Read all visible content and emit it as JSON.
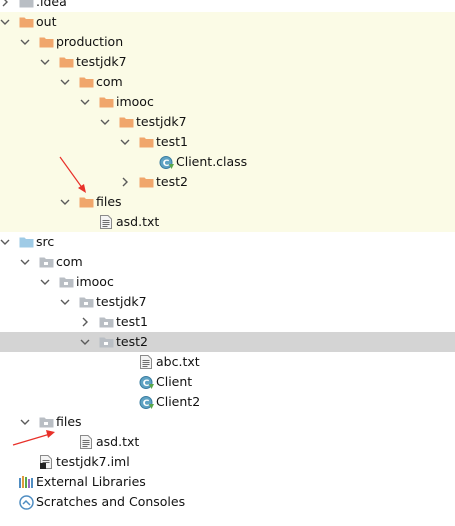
{
  "project_tree": {
    "rows": [
      {
        "label": ".idea",
        "icon": "folder-gray-icon",
        "expanded": false,
        "depth": 0,
        "style": "normal"
      },
      {
        "label": "out",
        "icon": "folder-orange-icon",
        "expanded": true,
        "depth": 0,
        "style": "excluded"
      },
      {
        "label": "production",
        "icon": "folder-orange-icon",
        "expanded": true,
        "depth": 1,
        "style": "excluded"
      },
      {
        "label": "testjdk7",
        "icon": "folder-orange-icon",
        "expanded": true,
        "depth": 2,
        "style": "excluded"
      },
      {
        "label": "com",
        "icon": "folder-orange-icon",
        "expanded": true,
        "depth": 3,
        "style": "excluded"
      },
      {
        "label": "imooc",
        "icon": "folder-orange-icon",
        "expanded": true,
        "depth": 4,
        "style": "excluded"
      },
      {
        "label": "testjdk7",
        "icon": "folder-orange-icon",
        "expanded": true,
        "depth": 5,
        "style": "excluded"
      },
      {
        "label": "test1",
        "icon": "folder-orange-icon",
        "expanded": true,
        "depth": 6,
        "style": "excluded"
      },
      {
        "label": "Client.class",
        "icon": "java-class-icon",
        "expanded": null,
        "depth": 7,
        "style": "excluded"
      },
      {
        "label": "test2",
        "icon": "folder-orange-icon",
        "expanded": false,
        "depth": 6,
        "style": "excluded"
      },
      {
        "label": "files",
        "icon": "folder-orange-icon",
        "expanded": true,
        "depth": 3,
        "style": "excluded"
      },
      {
        "label": "asd.txt",
        "icon": "text-file-icon",
        "expanded": null,
        "depth": 4,
        "style": "excluded"
      },
      {
        "label": "src",
        "icon": "folder-blue-icon",
        "expanded": true,
        "depth": 0,
        "style": "normal"
      },
      {
        "label": "com",
        "icon": "package-icon",
        "expanded": true,
        "depth": 1,
        "style": "normal"
      },
      {
        "label": "imooc",
        "icon": "package-icon",
        "expanded": true,
        "depth": 2,
        "style": "normal"
      },
      {
        "label": "testjdk7",
        "icon": "package-icon",
        "expanded": true,
        "depth": 3,
        "style": "normal"
      },
      {
        "label": "test1",
        "icon": "package-icon",
        "expanded": false,
        "depth": 4,
        "style": "normal"
      },
      {
        "label": "test2",
        "icon": "package-icon",
        "expanded": true,
        "depth": 4,
        "style": "selected"
      },
      {
        "label": "abc.txt",
        "icon": "text-file-icon",
        "expanded": null,
        "depth": 6,
        "style": "normal"
      },
      {
        "label": "Client",
        "icon": "java-class-icon",
        "expanded": null,
        "depth": 6,
        "style": "normal"
      },
      {
        "label": "Client2",
        "icon": "java-class-icon",
        "expanded": null,
        "depth": 6,
        "style": "normal"
      },
      {
        "label": "files",
        "icon": "package-icon",
        "expanded": true,
        "depth": 1,
        "style": "normal"
      },
      {
        "label": "asd.txt",
        "icon": "text-file-icon",
        "expanded": null,
        "depth": 3,
        "style": "normal"
      },
      {
        "label": "testjdk7.iml",
        "icon": "iml-file-icon",
        "expanded": null,
        "depth": 1,
        "style": "normal"
      },
      {
        "label": "External Libraries",
        "icon": "external-libraries-icon",
        "expanded": null,
        "depth": 0,
        "style": "normal"
      },
      {
        "label": "Scratches and Consoles",
        "icon": "scratches-icon",
        "expanded": null,
        "depth": 0,
        "style": "normal"
      }
    ]
  },
  "colors": {
    "excluded_background": "#fbfbe6",
    "selected_background": "#d4d4d4",
    "folder_orange": "#f0a66c",
    "folder_blue": "#9fcbe6",
    "folder_gray": "#b9bec4",
    "annotation_red": "#e8312a"
  },
  "annotations": [
    {
      "name": "red-arrow-out-files",
      "color": "#e8312a"
    },
    {
      "name": "red-arrow-src-files",
      "color": "#e8312a"
    }
  ]
}
